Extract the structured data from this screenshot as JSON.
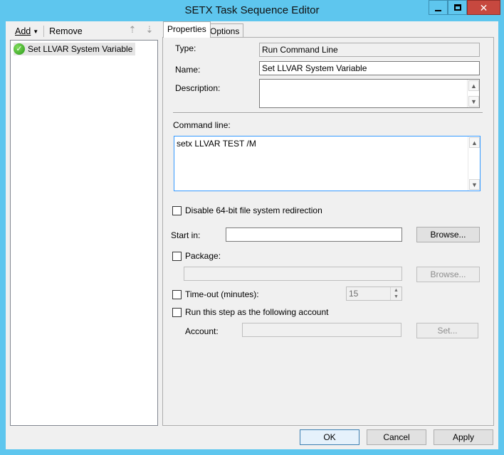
{
  "window": {
    "title": "SETX Task Sequence Editor"
  },
  "toolbar": {
    "add_label": "Add",
    "remove_label": "Remove"
  },
  "tree": {
    "items": [
      {
        "label": "Set LLVAR System Variable",
        "status": "success"
      }
    ]
  },
  "tabs": [
    {
      "label": "Properties",
      "active": true
    },
    {
      "label": "Options",
      "active": false
    }
  ],
  "properties": {
    "type_label": "Type:",
    "type_value": "Run Command Line",
    "name_label": "Name:",
    "name_value": "Set LLVAR System Variable",
    "description_label": "Description:",
    "description_value": "",
    "command_line_label": "Command line:",
    "command_line_value": "setx LLVAR TEST /M",
    "disable_redirection_label": "Disable 64-bit file system redirection",
    "disable_redirection_checked": false,
    "start_in_label": "Start in:",
    "start_in_value": "",
    "browse_label": "Browse...",
    "package_label": "Package:",
    "package_checked": false,
    "package_value": "",
    "package_browse_label": "Browse...",
    "timeout_label": "Time-out (minutes):",
    "timeout_checked": false,
    "timeout_value": "15",
    "run_as_label": "Run this step as the following account",
    "run_as_checked": false,
    "account_label": "Account:",
    "account_value": "",
    "set_label": "Set..."
  },
  "buttons": {
    "ok": "OK",
    "cancel": "Cancel",
    "apply": "Apply"
  }
}
